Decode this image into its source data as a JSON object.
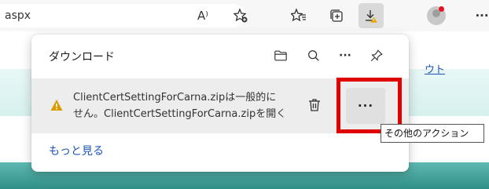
{
  "browser": {
    "address_text": "aspx",
    "read_aloud_icon": "A⁾",
    "more_label": "···"
  },
  "page": {
    "link_text": "ウト"
  },
  "downloads_panel": {
    "title": "ダウンロード",
    "header_more_label": "···",
    "item": {
      "line1": "ClientCertSettingForCarna.zipは一般的に",
      "line2": "せん。ClientCertSettingForCarna.zipを開く",
      "more_actions_label": "···"
    },
    "see_more_label": "もっと見る"
  },
  "tooltip": {
    "text": "その他のアクション"
  },
  "colors": {
    "link": "#1a55b5",
    "warning": "#d99b00",
    "highlight": "#e10000",
    "teal": "#2f8f88"
  }
}
